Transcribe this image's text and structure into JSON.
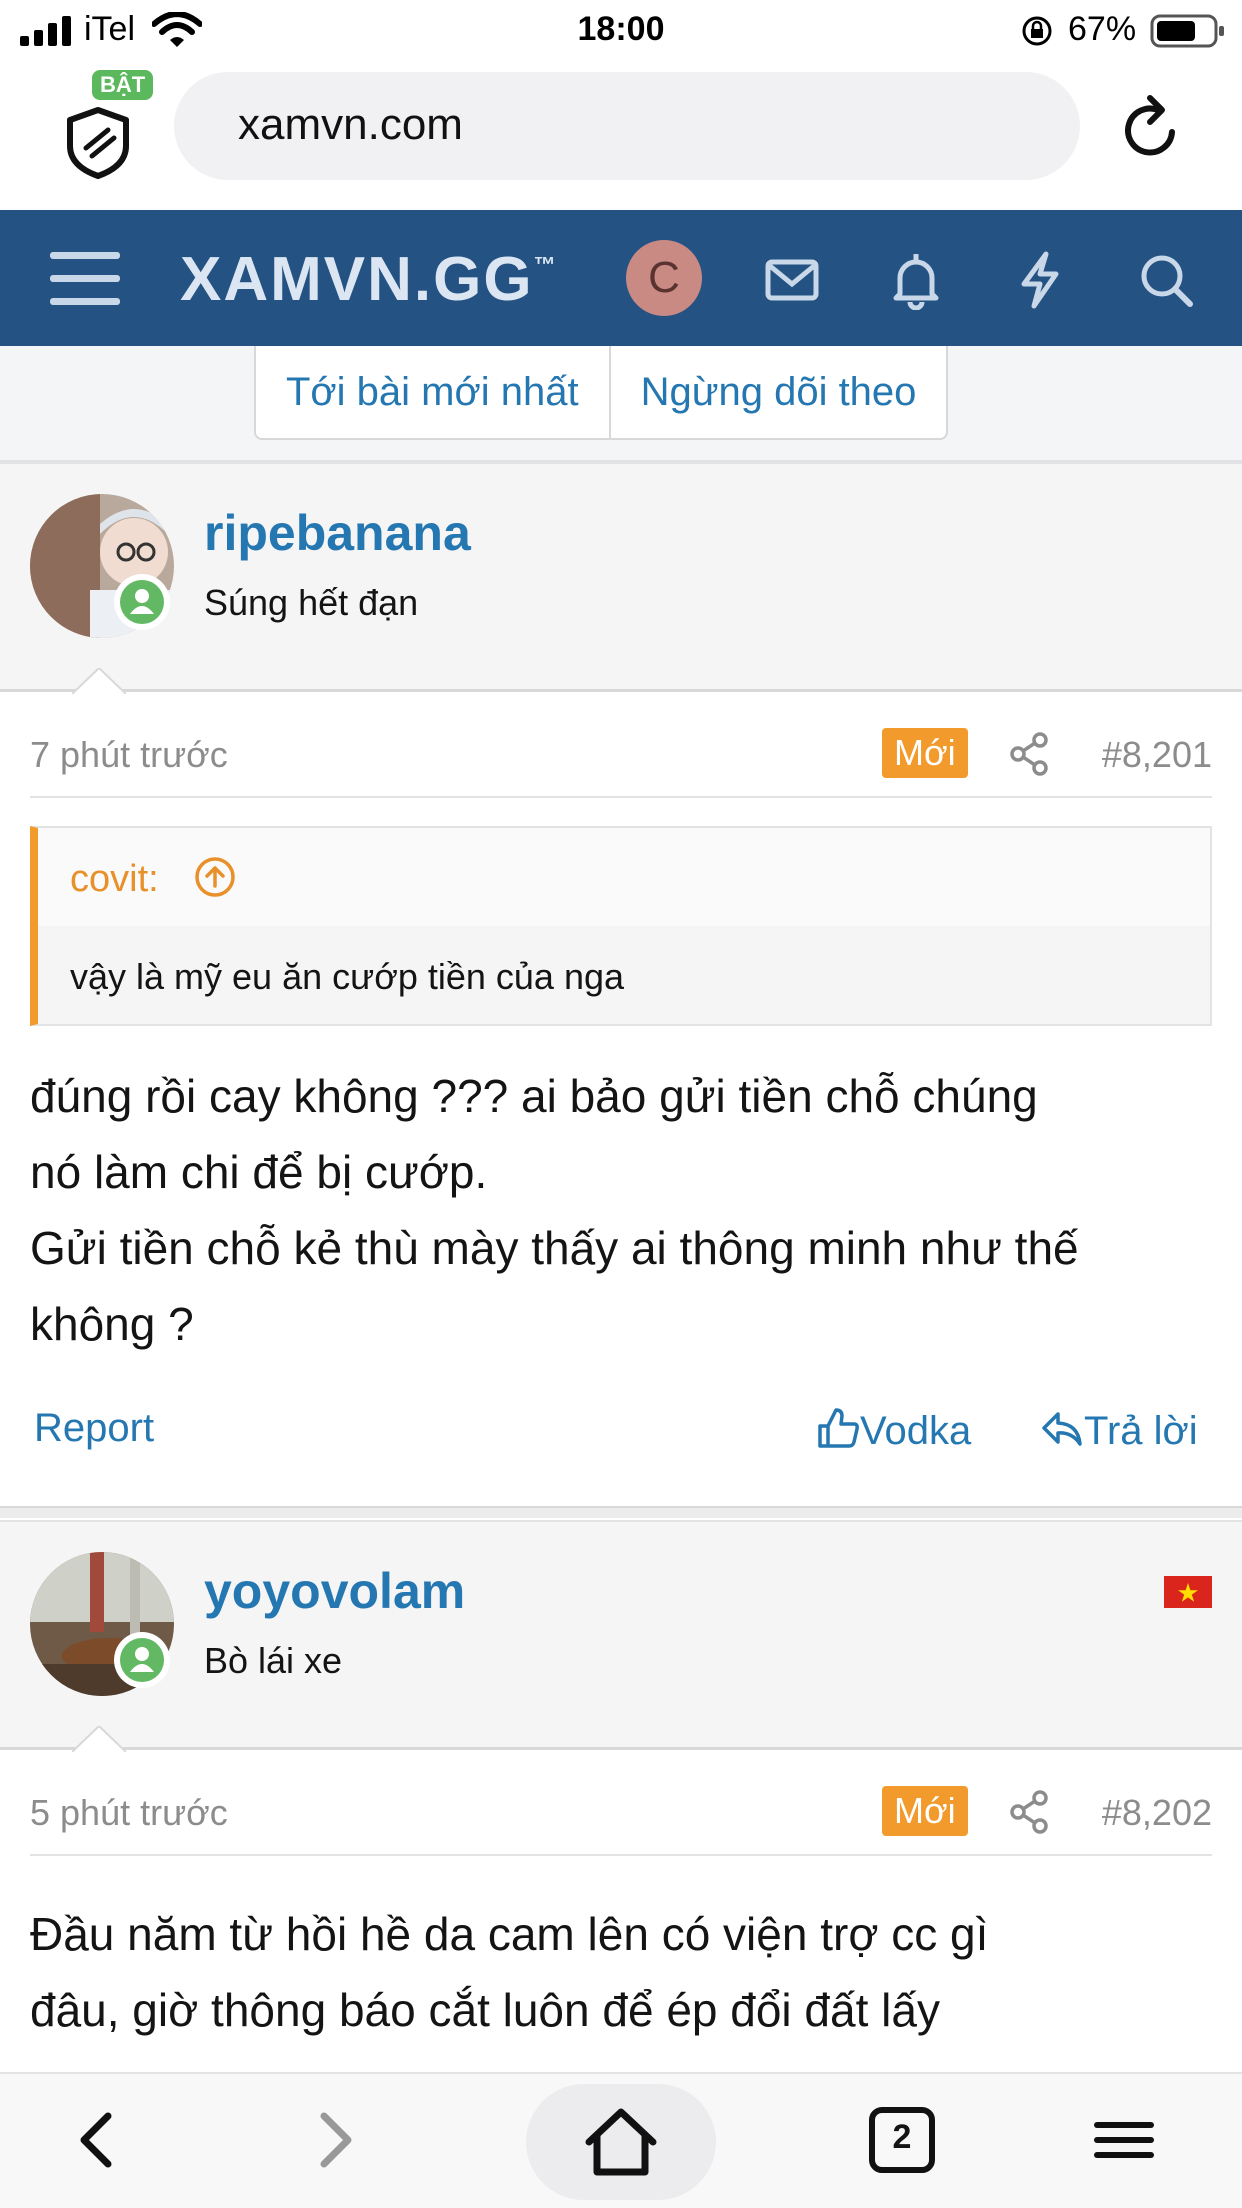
{
  "status_bar": {
    "carrier": "iTel",
    "time": "18:00",
    "battery": "67%"
  },
  "browser": {
    "shield_badge": "BẬT",
    "url": "xamvn.com",
    "tab_count": "2"
  },
  "site": {
    "logo": "XAMVN",
    "logo_suffix": ".GG",
    "trademark": "™",
    "avatar_letter": "C"
  },
  "thread_buttons": {
    "latest": "Tới bài mới nhất",
    "unwatch": "Ngừng dõi theo"
  },
  "posts": [
    {
      "username": "ripebanana",
      "user_title": "Súng hết đạn",
      "time": "7 phút trước",
      "badge": "Mới",
      "number": "#8,201",
      "quote": {
        "author": "covit:",
        "text": "vậy là mỹ eu ăn cướp tiền của nga"
      },
      "body_lines": [
        "đúng rồi cay không ??? ai bảo gửi tiền chỗ chúng",
        "nó làm chi để bị cướp.",
        "Gửi tiền chỗ kẻ thù mày thấy ai thông minh như thế",
        "không ?"
      ],
      "actions": {
        "report": "Report",
        "like": "Vodka",
        "reply": "Trả lời"
      }
    },
    {
      "username": "yoyovolam",
      "user_title": "Bò lái xe",
      "time": "5 phút trước",
      "badge": "Mới",
      "number": "#8,202",
      "body_lines": [
        "Đầu năm từ hồi hề da cam lên có viện trợ cc gì",
        "đâu, giờ thông báo cắt luôn để ép đổi đất lấy"
      ]
    }
  ],
  "colors": {
    "header_bg": "#245283",
    "link": "#2577b1",
    "accent": "#f29b2c",
    "online": "#63b963"
  },
  "icons": [
    "signal-icon",
    "wifi-icon",
    "lock-rotation-icon",
    "battery-icon",
    "shield-icon",
    "reload-icon",
    "hamburger-icon",
    "mail-icon",
    "bell-icon",
    "lightning-icon",
    "search-icon",
    "share-icon",
    "arrow-up-circle-icon",
    "thumbs-up-icon",
    "reply-icon",
    "back-icon",
    "forward-icon",
    "home-icon",
    "tabs-icon",
    "menu-icon"
  ]
}
